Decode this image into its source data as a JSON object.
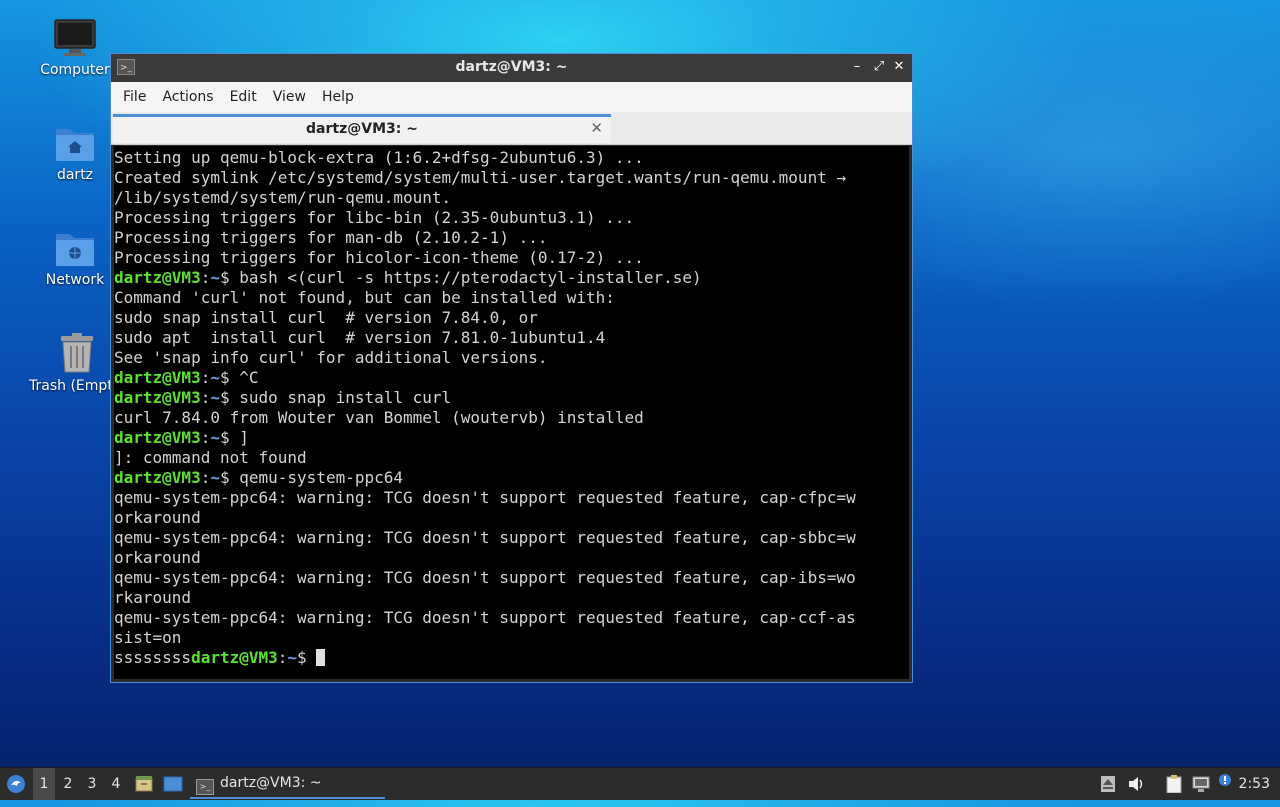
{
  "desktop": {
    "icons": [
      {
        "label": "Computer",
        "icon": "monitor-icon"
      },
      {
        "label": "dartz",
        "icon": "home-folder-icon"
      },
      {
        "label": "Network",
        "icon": "network-folder-icon"
      },
      {
        "label": "Trash (Empt",
        "icon": "trash-icon"
      }
    ]
  },
  "window": {
    "title": "dartz@VM3: ~",
    "controls": {
      "minimize": "–",
      "maximize": "⤢",
      "close": "✕"
    },
    "menu": [
      "File",
      "Actions",
      "Edit",
      "View",
      "Help"
    ],
    "tab": {
      "label": "dartz@VM3: ~",
      "close": "✕"
    }
  },
  "terminal": {
    "user_host": "dartz@VM3",
    "path": "~",
    "lines": [
      {
        "type": "out",
        "text": "Setting up qemu-block-extra (1:6.2+dfsg-2ubuntu6.3) ..."
      },
      {
        "type": "out",
        "text": "Created symlink /etc/systemd/system/multi-user.target.wants/run-qemu.mount →"
      },
      {
        "type": "out",
        "text": "/lib/systemd/system/run-qemu.mount."
      },
      {
        "type": "out",
        "text": "Processing triggers for libc-bin (2.35-0ubuntu3.1) ..."
      },
      {
        "type": "out",
        "text": "Processing triggers for man-db (2.10.2-1) ..."
      },
      {
        "type": "out",
        "text": "Processing triggers for hicolor-icon-theme (0.17-2) ..."
      },
      {
        "type": "cmd",
        "text": "bash <(curl -s https://pterodactyl-installer.se)"
      },
      {
        "type": "out",
        "text": "Command 'curl' not found, but can be installed with:"
      },
      {
        "type": "out",
        "text": "sudo snap install curl  # version 7.84.0, or"
      },
      {
        "type": "out",
        "text": "sudo apt  install curl  # version 7.81.0-1ubuntu1.4"
      },
      {
        "type": "out",
        "text": "See 'snap info curl' for additional versions."
      },
      {
        "type": "cmd",
        "text": "^C"
      },
      {
        "type": "cmd",
        "text": "sudo snap install curl"
      },
      {
        "type": "out",
        "text": "curl 7.84.0 from Wouter van Bommel (woutervb) installed"
      },
      {
        "type": "cmd",
        "text": "]"
      },
      {
        "type": "out",
        "text": "]: command not found"
      },
      {
        "type": "cmd",
        "text": "qemu-system-ppc64"
      },
      {
        "type": "out",
        "text": "qemu-system-ppc64: warning: TCG doesn't support requested feature, cap-cfpc=w"
      },
      {
        "type": "out",
        "text": "orkaround"
      },
      {
        "type": "out",
        "text": "qemu-system-ppc64: warning: TCG doesn't support requested feature, cap-sbbc=w"
      },
      {
        "type": "out",
        "text": "orkaround"
      },
      {
        "type": "out",
        "text": "qemu-system-ppc64: warning: TCG doesn't support requested feature, cap-ibs=wo"
      },
      {
        "type": "out",
        "text": "rkaround"
      },
      {
        "type": "out",
        "text": "qemu-system-ppc64: warning: TCG doesn't support requested feature, cap-ccf-as"
      },
      {
        "type": "out",
        "text": "sist=on"
      },
      {
        "type": "prompt_prefixed",
        "prefix": "ssssssss",
        "text": ""
      }
    ]
  },
  "taskbar": {
    "workspaces": [
      "1",
      "2",
      "3",
      "4"
    ],
    "active_workspace": "1",
    "task_label": "dartz@VM3: ~",
    "clock": "2:53"
  },
  "colors": {
    "prompt_user": "#5ae22f",
    "prompt_path": "#6f9ee8",
    "accent": "#4a90d9"
  }
}
